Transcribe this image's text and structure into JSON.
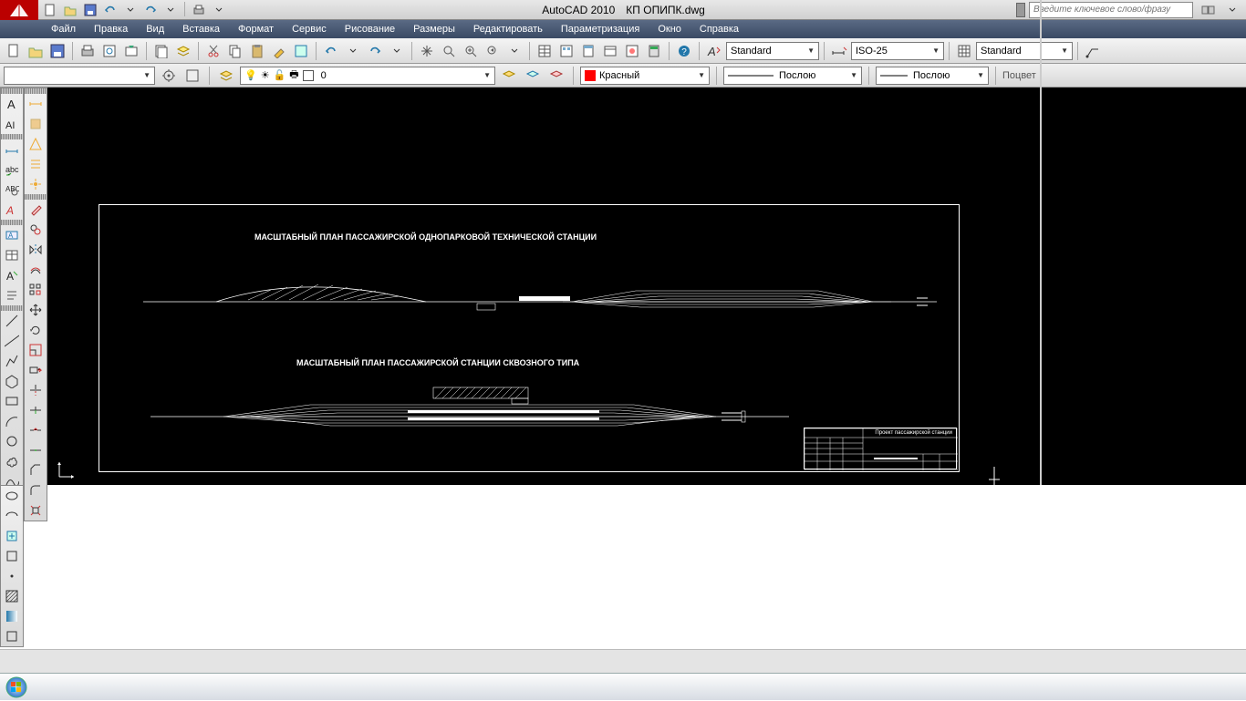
{
  "app": {
    "name": "AutoCAD 2010",
    "document": "КП ОПИПК.dwg",
    "search_placeholder": "Введите ключевое слово/фразу"
  },
  "menu": [
    "Файл",
    "Правка",
    "Вид",
    "Вставка",
    "Формат",
    "Сервис",
    "Рисование",
    "Размеры",
    "Редактировать",
    "Параметризация",
    "Окно",
    "Справка"
  ],
  "combos": {
    "text_style": "Standard",
    "dim_style": "ISO-25",
    "table_style": "Standard",
    "layer": "0",
    "color": "Красный",
    "linetype": "Послою",
    "lineweight": "Послою",
    "plotstyle": "Поцвет"
  },
  "drawing": {
    "title1": "МАСШТАБНЫЙ ПЛАН ПАССАЖИРСКОЙ ОДНОПАРКОВОЙ ТЕХНИЧЕСКОЙ СТАНЦИИ",
    "title2": "МАСШТАБНЫЙ ПЛАН ПАССАЖИРСКОЙ СТАНЦИИ СКВОЗНОГО ТИПА",
    "titleblock_caption": "Проект пассажирской станции"
  },
  "icons": {
    "new": "new-icon",
    "open": "open-icon",
    "save": "save-icon",
    "undo": "undo-icon",
    "redo": "redo-icon",
    "print": "print-icon",
    "plot": "plot-icon",
    "cut": "cut-icon",
    "copy": "copy-icon",
    "paste": "paste-icon",
    "zoom": "zoom-icon",
    "pan": "pan-icon"
  }
}
